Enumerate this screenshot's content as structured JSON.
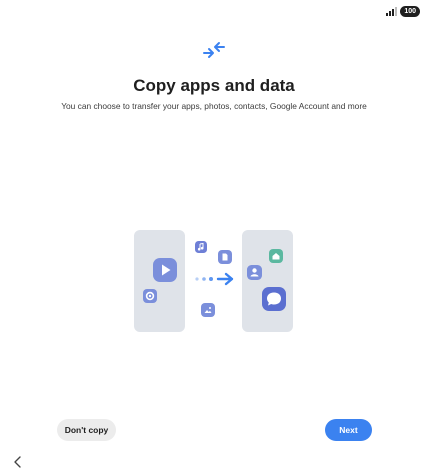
{
  "status_bar": {
    "signal_icon": "signal-icon",
    "battery_level": "100"
  },
  "header": {
    "icon": "transfer-arrows-icon"
  },
  "title": "Copy apps and data",
  "subtitle": "You can choose to transfer your apps, photos, contacts, Google Account and more",
  "illustration": {
    "left_phone_icons": [
      "play-icon",
      "settings-icon"
    ],
    "floating_icons": [
      "music-icon",
      "file-icon",
      "photo-icon"
    ],
    "right_phone_icons": [
      "home-icon",
      "contact-icon",
      "message-icon"
    ],
    "arrow_color": "#3b82f0"
  },
  "buttons": {
    "dont_copy_label": "Don't copy",
    "next_label": "Next"
  },
  "nav": {
    "back_icon": "chevron-left-icon"
  },
  "colors": {
    "accent": "#3b82f0",
    "icon_purple": "#6e7fd6",
    "icon_teal": "#5bb8a0"
  }
}
